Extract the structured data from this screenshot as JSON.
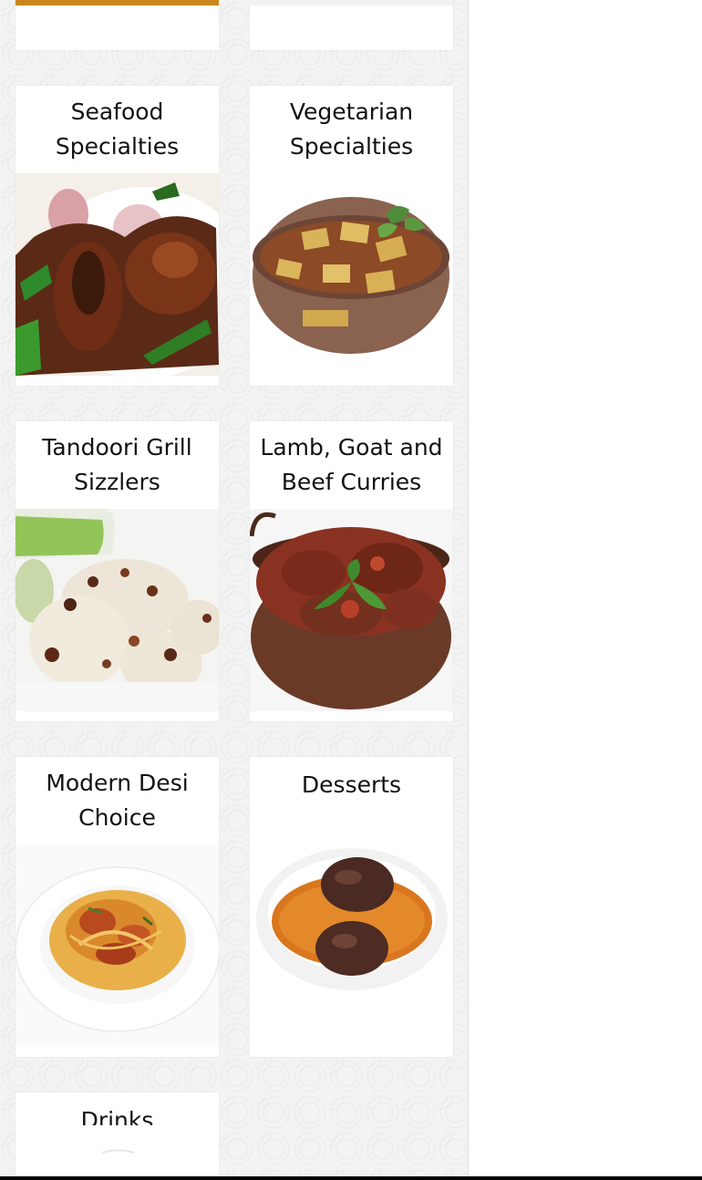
{
  "categories": [
    {
      "title": "Seafood Specialties",
      "image": "seafood-dish-image"
    },
    {
      "title": "Vegetarian Specialties",
      "image": "paneer-curry-image"
    },
    {
      "title": "Tandoori Grill Sizzlers",
      "image": "tandoori-chicken-image"
    },
    {
      "title": "Lamb, Goat and Beef Curries",
      "image": "lamb-curry-image"
    },
    {
      "title": "Modern Desi Choice",
      "image": "pasta-dish-image"
    },
    {
      "title": "Desserts",
      "image": "gulab-jamun-image"
    },
    {
      "title": "Drinks",
      "image": "drinks-image"
    }
  ],
  "colors": {
    "background": "#f3f3f3",
    "card": "#ffffff",
    "text": "#111111"
  }
}
